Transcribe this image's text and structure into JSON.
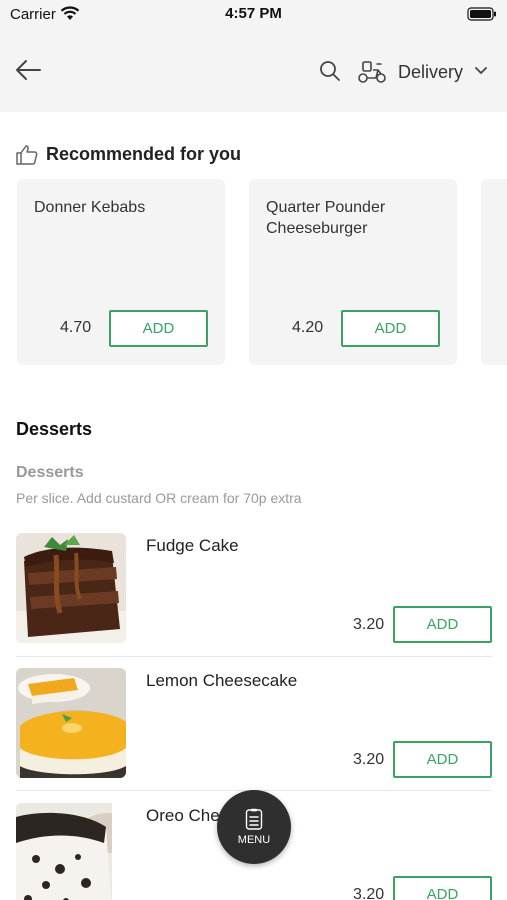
{
  "status_bar": {
    "carrier": "Carrier",
    "time": "4:57 PM"
  },
  "nav": {
    "delivery_label": "Delivery",
    "icons": [
      "back-arrow-icon",
      "search-icon",
      "scooter-icon",
      "chevron-down-icon"
    ]
  },
  "recommended": {
    "title": "Recommended for you",
    "items": [
      {
        "name": "Donner Kebabs",
        "price": "4.70",
        "add_label": "ADD"
      },
      {
        "name": "Quarter Pounder Cheeseburger",
        "price": "4.20",
        "add_label": "ADD"
      }
    ]
  },
  "desserts": {
    "category_title": "Desserts",
    "subcategory_title": "Desserts",
    "subcategory_desc": "Per slice. Add custard OR cream for 70p extra",
    "items": [
      {
        "name": "Fudge Cake",
        "price": "3.20",
        "add_label": "ADD"
      },
      {
        "name": "Lemon Cheesecake",
        "price": "3.20",
        "add_label": "ADD"
      },
      {
        "name": "Oreo Che",
        "price": "3.20",
        "add_label": "ADD"
      }
    ]
  },
  "fab": {
    "label": "MENU"
  },
  "colors": {
    "accent": "#3aa364",
    "header_bg": "#f4f4f4",
    "fab_bg": "#2f2f2f"
  }
}
